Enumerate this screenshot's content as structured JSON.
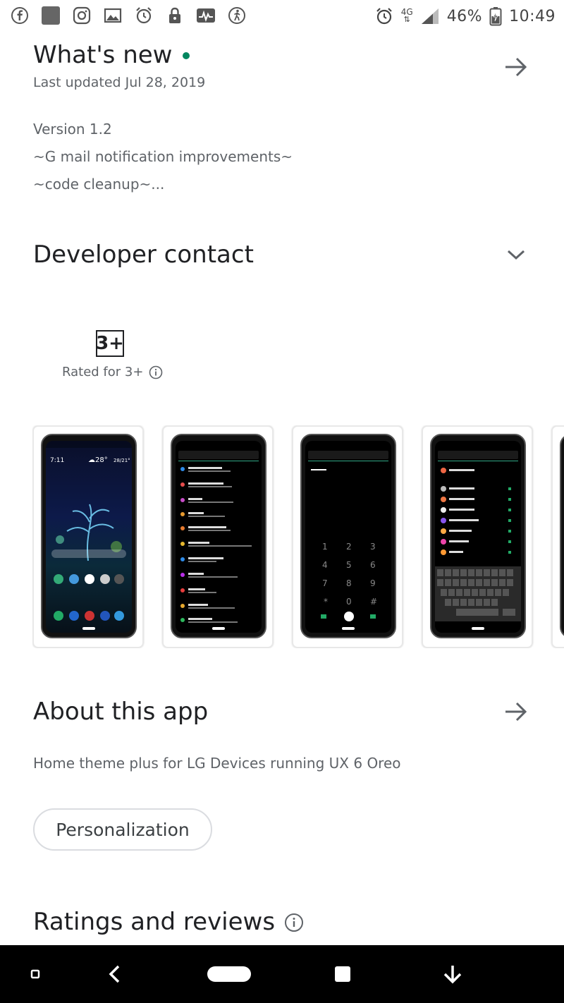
{
  "status_bar": {
    "left_icons": [
      "facebook-icon",
      "app-square-icon",
      "instagram-icon",
      "gallery-icon",
      "alarm-clock-icon",
      "lock-icon",
      "pulse-icon",
      "fitness-icon"
    ],
    "network": "4G",
    "battery": "46%",
    "time": "10:49"
  },
  "whats_new": {
    "title": "What's new",
    "last_updated": "Last updated Jul 28, 2019",
    "version": "Version 1.2",
    "line1": "~G mail notification improvements~",
    "line2": "~code cleanup~..."
  },
  "developer_contact": {
    "title": "Developer contact"
  },
  "rating": {
    "badge": "3+",
    "label": "Rated for 3+"
  },
  "screenshots": {
    "items": [
      "home-screen",
      "settings-screen",
      "dialer-screen",
      "contacts-screen"
    ]
  },
  "about": {
    "title": "About this app",
    "description": "Home theme plus for LG Devices running UX 6 Oreo",
    "category": "Personalization"
  },
  "ratings": {
    "title": "Ratings and reviews"
  },
  "colors": {
    "accent_green": "#01875f",
    "text_primary": "#202124",
    "text_secondary": "#5f6368"
  }
}
